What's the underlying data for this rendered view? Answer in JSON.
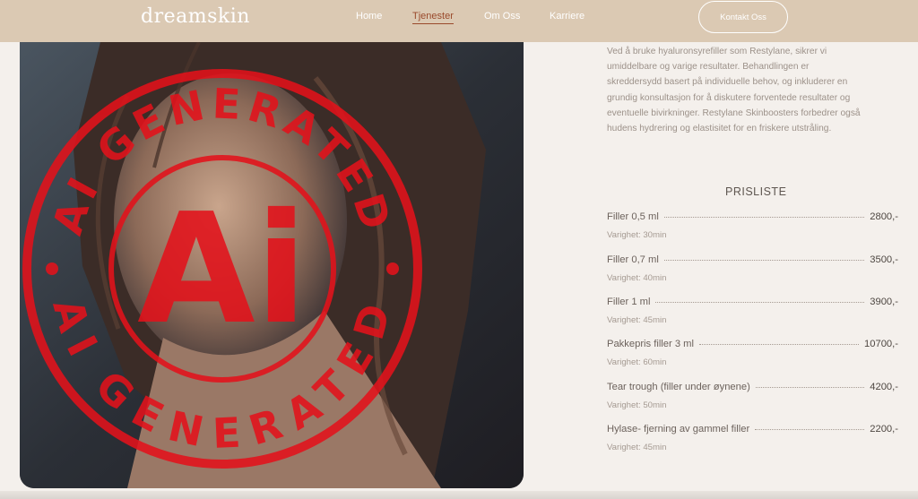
{
  "header": {
    "logo": "dreamskin",
    "nav": [
      {
        "label": "Home",
        "active": false
      },
      {
        "label": "Tjenester",
        "active": true
      },
      {
        "label": "Om Oss",
        "active": false
      },
      {
        "label": "Karriere",
        "active": false
      }
    ],
    "contact_label": "Kontakt Oss"
  },
  "hero": {
    "stamp_text_top": "AI GENERATED",
    "stamp_text_bottom": "AI GENERATED",
    "stamp_center": "Ai"
  },
  "content": {
    "description": "Ved å bruke hyaluronsyrefiller som Restylane, sikrer vi umiddelbare og varige resultater. Behandlingen er skreddersydd basert på individuelle behov, og inkluderer en grundig konsultasjon for å diskutere forventede resultater og eventuelle bivirkninger. Restylane Skinboosters forbedrer også hudens hydrering og elastisitet for en friskere utstråling.",
    "price_title": "PRISLISTE",
    "prices": [
      {
        "name": "Filler 0,5 ml",
        "price": "2800,-",
        "duration": "Varighet: 30min"
      },
      {
        "name": "Filler 0,7 ml",
        "price": "3500,-",
        "duration": "Varighet: 40min"
      },
      {
        "name": "Filler 1 ml",
        "price": "3900,-",
        "duration": "Varighet: 45min"
      },
      {
        "name": "Pakkepris filler 3 ml",
        "price": "10700,-",
        "duration": "Varighet: 60min"
      },
      {
        "name": "Tear trough (filler under øynene)",
        "price": "4200,-",
        "duration": "Varighet: 50min"
      },
      {
        "name": "Hylase- fjerning av gammel filler",
        "price": "2200,-",
        "duration": "Varighet: 45min"
      }
    ]
  },
  "colors": {
    "header_bg": "#dbc9b3",
    "accent": "#9a4a2c",
    "stamp": "#e3121b",
    "page_bg": "#f4f0ec"
  }
}
